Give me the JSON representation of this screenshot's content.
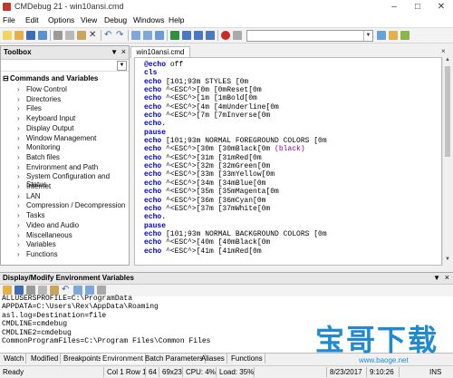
{
  "window": {
    "title": "CMDebug 21 - win10ansi.cmd"
  },
  "menu": [
    "File",
    "Edit",
    "Options",
    "View",
    "Debug",
    "Windows",
    "Help"
  ],
  "toolbox": {
    "title": "Toolbox",
    "root": "Commands and Variables",
    "items": [
      "Flow Control",
      "Directories",
      "Files",
      "Keyboard Input",
      "Display Output",
      "Window Management",
      "Monitoring",
      "Batch files",
      "Environment and Path",
      "System Configuration and Status",
      "Internet",
      "LAN",
      "Compression / Decompression",
      "Tasks",
      "Video and Audio",
      "Miscellaneous",
      "Variables",
      "Functions"
    ]
  },
  "editor": {
    "tab": "win10ansi.cmd",
    "lines": [
      [
        "@echo off",
        "kw"
      ],
      [
        "cls",
        "kw"
      ],
      [
        "echo [101;93m STYLES [0m",
        "kw"
      ],
      [
        "echo ^<ESC^>[0m [0mReset[0m",
        "kw"
      ],
      [
        "echo ^<ESC^>[1m [1mBold[0m",
        "kw"
      ],
      [
        "echo ^<ESC^>[4m [4mUnderline[0m",
        "kw"
      ],
      [
        "echo ^<ESC^>[7m [7mInverse[0m",
        "kw"
      ],
      [
        "echo.",
        "kw"
      ],
      [
        "pause",
        "kw"
      ],
      [
        "echo [101;93m NORMAL FOREGROUND COLORS [0m",
        "kw"
      ],
      [
        "echo ^<ESC^>[30m [30mBlack[0m (black)",
        "kw"
      ],
      [
        "echo ^<ESC^>[31m [31mRed[0m",
        "kw"
      ],
      [
        "echo ^<ESC^>[32m [32mGreen[0m",
        "kw"
      ],
      [
        "echo ^<ESC^>[33m [33mYellow[0m",
        "kw"
      ],
      [
        "echo ^<ESC^>[34m [34mBlue[0m",
        "kw"
      ],
      [
        "echo ^<ESC^>[35m [35mMagenta[0m",
        "kw"
      ],
      [
        "echo ^<ESC^>[36m [36mCyan[0m",
        "kw"
      ],
      [
        "echo ^<ESC^>[37m [37mWhite[0m",
        "kw"
      ],
      [
        "echo.",
        "kw"
      ],
      [
        "pause",
        "kw"
      ],
      [
        "echo [101;93m NORMAL BACKGROUND COLORS [0m",
        "kw"
      ],
      [
        "echo ^<ESC^>[40m [40mBlack[0m",
        "kw"
      ],
      [
        "echo ^<ESC^>[41m [41mRed[0m",
        "kw"
      ]
    ]
  },
  "env": {
    "title": "Display/Modify Environment Variables",
    "vars": [
      "ALLUSERSPROFILE=C:\\ProgramData",
      "APPDATA=C:\\Users\\Rex\\AppData\\Roaming",
      "asl.log=Destination=file",
      "CMDLINE=cmdebug",
      "CMDLINE2=cmdebug",
      "CommonProgramFiles=C:\\Program Files\\Common Files"
    ]
  },
  "bottom_tabs": [
    "Watch",
    "Modified",
    "Breakpoints",
    "Environment",
    "Batch Parameters",
    "Aliases",
    "Functions"
  ],
  "status": {
    "ready": "Ready",
    "pos": "Col 1  Row 1",
    "s64": "64",
    "size": "69x23",
    "cpu": "CPU: 4%",
    "load": "Load: 35%",
    "date": "8/23/2017",
    "time": "9:10:26",
    "ins": "INS"
  },
  "watermark": {
    "text": "宝哥下载",
    "url": "www.baoge.net"
  },
  "colors": {
    "keyword": "#0000c8",
    "accent": "#1e8bd0"
  }
}
